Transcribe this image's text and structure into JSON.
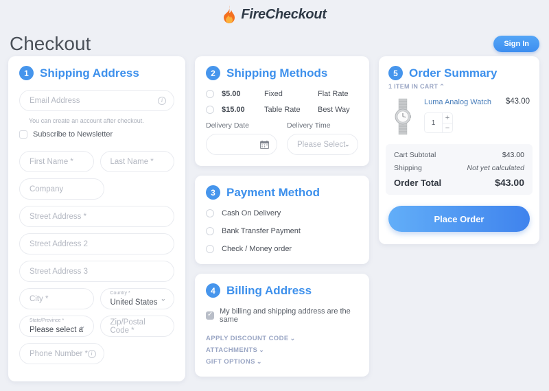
{
  "brand": {
    "name": "FireCheckout",
    "icon": "flame-icon",
    "accent": "#3d90ec"
  },
  "header": {
    "title": "Checkout",
    "sign_in_label": "Sign In"
  },
  "shipping_address": {
    "step": "1",
    "title": "Shipping Address",
    "email_placeholder": "Email Address",
    "email_value": "",
    "email_hint": "You can create an account after checkout.",
    "newsletter_label": "Subscribe to Newsletter",
    "fields": {
      "first_name": "First Name *",
      "last_name": "Last Name *",
      "company": "Company",
      "street1": "Street Address *",
      "street2": "Street Address 2",
      "street3": "Street Address 3",
      "city": "City *",
      "zip": "Zip/Postal Code *",
      "phone": "Phone Number *"
    },
    "country": {
      "label": "Country *",
      "value": "United States"
    },
    "state": {
      "label": "State/Province *",
      "value": "Please select a regio"
    }
  },
  "shipping_methods": {
    "step": "2",
    "title": "Shipping Methods",
    "options": [
      {
        "price": "$5.00",
        "method": "Fixed",
        "carrier": "Flat Rate",
        "selected": false
      },
      {
        "price": "$15.00",
        "method": "Table Rate",
        "carrier": "Best Way",
        "selected": false
      }
    ],
    "delivery_date_label": "Delivery Date",
    "delivery_date_value": "",
    "delivery_time_label": "Delivery Time",
    "delivery_time_value": "Please Select"
  },
  "payment_method": {
    "step": "3",
    "title": "Payment Method",
    "options": [
      {
        "label": "Cash On Delivery",
        "selected": false
      },
      {
        "label": "Bank Transfer Payment",
        "selected": false
      },
      {
        "label": "Check / Money order",
        "selected": false
      }
    ]
  },
  "billing_address": {
    "step": "4",
    "title": "Billing Address",
    "same_as_shipping_label": "My billing and shipping address are the same",
    "same_as_shipping_checked": true,
    "collapsibles": [
      {
        "label": "APPLY DISCOUNT CODE"
      },
      {
        "label": "ATTACHMENTS"
      },
      {
        "label": "GIFT OPTIONS"
      }
    ]
  },
  "order_summary": {
    "step": "5",
    "title": "Order Summary",
    "cart_count_label": "1 ITEM IN CART",
    "item": {
      "name": "Luma Analog Watch",
      "price": "$43.00",
      "qty": "1",
      "increment": "+",
      "decrement": "−",
      "thumb_alt": "watch-thumbnail"
    },
    "totals": [
      {
        "label": "Cart Subtotal",
        "value": "$43.00",
        "italic": false
      },
      {
        "label": "Shipping",
        "value": "Not yet calculated",
        "italic": true
      }
    ],
    "grand_total": {
      "label": "Order Total",
      "value": "$43.00"
    },
    "place_order_label": "Place Order"
  }
}
